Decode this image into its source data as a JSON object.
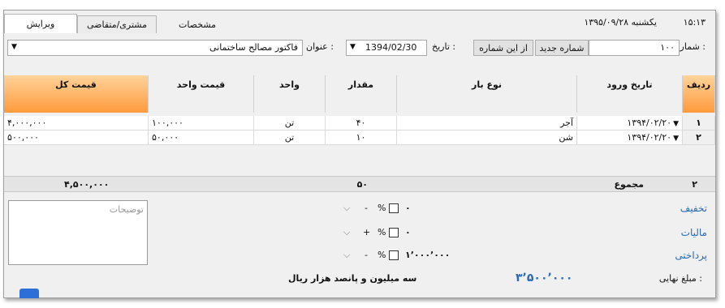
{
  "header": {
    "clock": "۱۵:۱۳",
    "date_text": "یکشنبه ۱۳۹۵/۰۹/۲۸"
  },
  "tabs": [
    {
      "label": "ویرایش"
    },
    {
      "label": "مشتری/متقاضی"
    },
    {
      "label": "مشخصات"
    }
  ],
  "form": {
    "number_label": "شماره :",
    "number_value": "۱۰۰",
    "new_number_button": "شماره جدید",
    "from_this_number_button": "از این شماره",
    "date_label": "تاریخ :",
    "date_value": "1394/02/30",
    "title_label": "عنوان :",
    "title_value": "فاکتور مصالح ساختمانی"
  },
  "grid": {
    "columns": [
      "ردیف",
      "تاریخ ورود",
      "نوع بار",
      "مقدار",
      "واحد",
      "قیمت واحد",
      "قیمت کل"
    ],
    "rows": [
      {
        "row": "۱",
        "date": "۱۳۹۴/۰۲/۲۰",
        "type": "آجر",
        "qty": "۴۰",
        "unit": "تن",
        "unit_price": "۱۰۰,۰۰۰",
        "total": "۴,۰۰۰,۰۰۰"
      },
      {
        "row": "۲",
        "date": "۱۳۹۴/۰۲/۲۰",
        "type": "شن",
        "qty": "۱۰",
        "unit": "تن",
        "unit_price": "۵۰,۰۰۰",
        "total": "۵۰۰,۰۰۰"
      }
    ],
    "summary": {
      "count": "۲",
      "label": "مجموع",
      "qty_total": "۵۰",
      "grand_total": "۴,۵۰۰,۰۰۰"
    }
  },
  "notes_placeholder": "توضیحات",
  "adjustments": [
    {
      "label": "تخفیف",
      "value": "۰",
      "percent": "%",
      "sign": "-"
    },
    {
      "label": "مالیات",
      "value": "۰",
      "percent": "%",
      "sign": "+"
    },
    {
      "label": "پرداختی",
      "value": "۱٬۰۰۰٬۰۰۰",
      "percent": "%",
      "sign": "-"
    }
  ],
  "final": {
    "label": "مبلغ نهایی :",
    "amount": "۳٬۵۰۰٬۰۰۰",
    "words": "سه میلیون و پانصد هزار ریال"
  },
  "colors": {
    "header_highlight": "#ff9a3c",
    "accent_blue": "#2a6ab0"
  }
}
